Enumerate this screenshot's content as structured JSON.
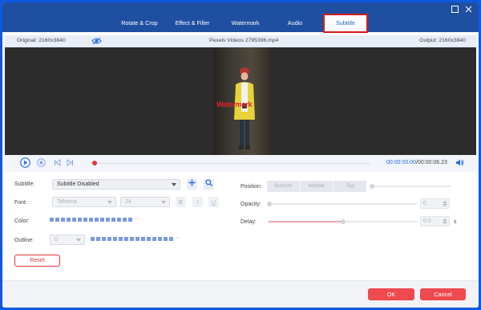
{
  "tabs": [
    {
      "label": "Rotate & Crop"
    },
    {
      "label": "Effect & Filter"
    },
    {
      "label": "Watermark"
    },
    {
      "label": "Audio"
    },
    {
      "label": "Subtitle",
      "active": true
    }
  ],
  "info": {
    "original": "Original: 2160x3840",
    "filename": "Pexels Videos 2795396.mp4",
    "output": "Output: 2160x3840"
  },
  "preview": {
    "watermark_text": "Watermark"
  },
  "player": {
    "current_time": "00:00:00.00",
    "total_time": "/00:00:06.23",
    "progress": 0
  },
  "subtitle": {
    "label": "Subtitle:",
    "value": "Subtitle Disabled"
  },
  "font": {
    "label": "Font:",
    "family": "Tahoma",
    "size": "24",
    "bold": "B",
    "italic": "I",
    "underline": "U"
  },
  "color": {
    "label": "Color:"
  },
  "outline": {
    "label": "Outline:",
    "value": "0"
  },
  "position": {
    "label": "Position:",
    "options": [
      "Bottom",
      "Middle",
      "Top"
    ]
  },
  "opacity": {
    "label": "Opacity:",
    "value": "0"
  },
  "delay": {
    "label": "Delay:",
    "value": "0.0",
    "unit": "s"
  },
  "buttons": {
    "reset": "Reset",
    "ok": "OK",
    "cancel": "Cancel"
  },
  "colors": {
    "titlebar": "#1f4fa0",
    "accent_red": "#ef4a4f",
    "accent_blue": "#2d6ae3"
  }
}
